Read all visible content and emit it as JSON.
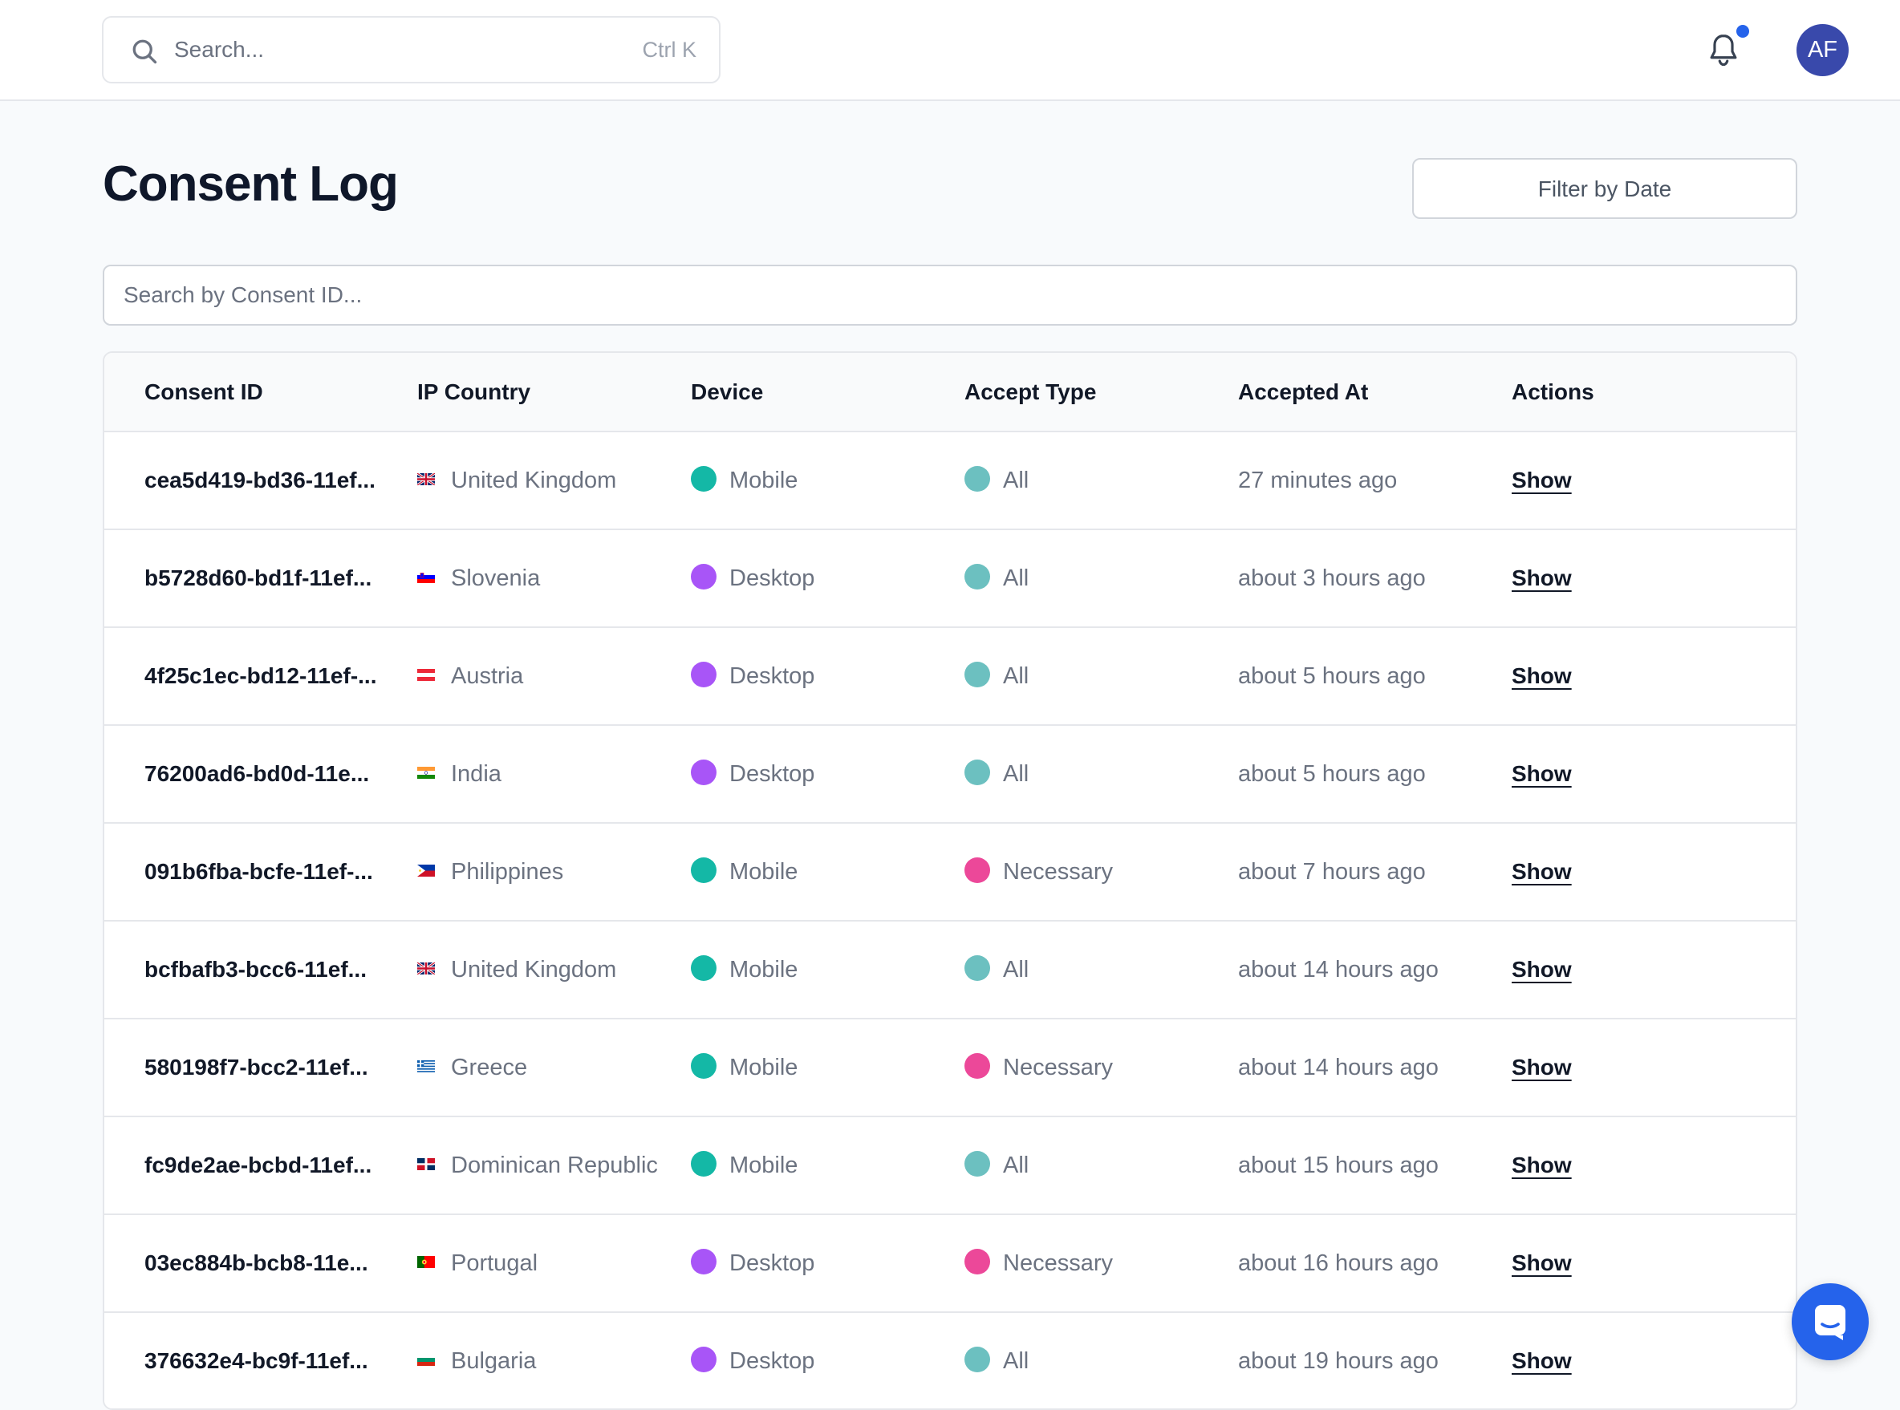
{
  "header": {
    "search_placeholder": "Search...",
    "search_shortcut": "Ctrl K",
    "avatar_initials": "AF",
    "notification_dot_color": "#2563eb"
  },
  "page": {
    "title": "Consent Log",
    "filter_button": "Filter by Date",
    "consent_search_placeholder": "Search by Consent ID..."
  },
  "table": {
    "columns": [
      "Consent ID",
      "IP Country",
      "Device",
      "Accept Type",
      "Accepted At",
      "Actions"
    ],
    "rows": [
      {
        "id": "cea5d419-bd36-11ef...",
        "country": "United Kingdom",
        "flag": "gb",
        "device": "Mobile",
        "accept": "All",
        "at": "27 minutes ago",
        "action": "Show"
      },
      {
        "id": "b5728d60-bd1f-11ef...",
        "country": "Slovenia",
        "flag": "si",
        "device": "Desktop",
        "accept": "All",
        "at": "about 3 hours ago",
        "action": "Show"
      },
      {
        "id": "4f25c1ec-bd12-11ef-...",
        "country": "Austria",
        "flag": "at",
        "device": "Desktop",
        "accept": "All",
        "at": "about 5 hours ago",
        "action": "Show"
      },
      {
        "id": "76200ad6-bd0d-11e...",
        "country": "India",
        "flag": "in",
        "device": "Desktop",
        "accept": "All",
        "at": "about 5 hours ago",
        "action": "Show"
      },
      {
        "id": "091b6fba-bcfe-11ef-...",
        "country": "Philippines",
        "flag": "ph",
        "device": "Mobile",
        "accept": "Necessary",
        "at": "about 7 hours ago",
        "action": "Show"
      },
      {
        "id": "bcfbafb3-bcc6-11ef...",
        "country": "United Kingdom",
        "flag": "gb",
        "device": "Mobile",
        "accept": "All",
        "at": "about 14 hours ago",
        "action": "Show"
      },
      {
        "id": "580198f7-bcc2-11ef...",
        "country": "Greece",
        "flag": "gr",
        "device": "Mobile",
        "accept": "Necessary",
        "at": "about 14 hours ago",
        "action": "Show"
      },
      {
        "id": "fc9de2ae-bcbd-11ef...",
        "country": "Dominican Republic",
        "flag": "do",
        "device": "Mobile",
        "accept": "All",
        "at": "about 15 hours ago",
        "action": "Show"
      },
      {
        "id": "03ec884b-bcb8-11e...",
        "country": "Portugal",
        "flag": "pt",
        "device": "Desktop",
        "accept": "Necessary",
        "at": "about 16 hours ago",
        "action": "Show"
      },
      {
        "id": "376632e4-bc9f-11ef...",
        "country": "Bulgaria",
        "flag": "bg",
        "device": "Desktop",
        "accept": "All",
        "at": "about 19 hours ago",
        "action": "Show"
      }
    ]
  },
  "colors": {
    "mobile": "#14b8a6",
    "desktop": "#a855f7",
    "accept_all": "#6cc0c0",
    "accept_necessary": "#ec4899",
    "chat_button": "#2563eb",
    "avatar": "#3949ab"
  },
  "icons": {
    "search": "search-icon",
    "bell": "bell-icon",
    "chat": "chat-icon"
  }
}
